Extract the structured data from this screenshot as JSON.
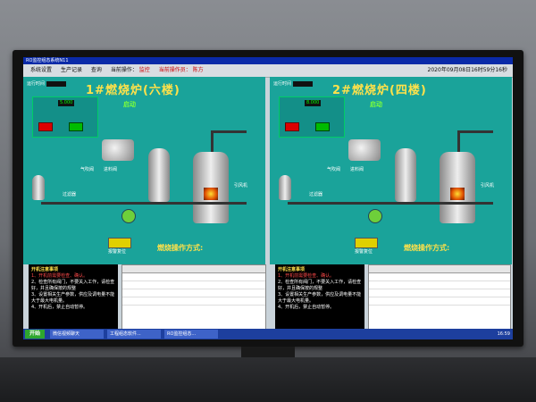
{
  "window": {
    "title": "RO监控组态系统N11"
  },
  "menu": {
    "items": [
      "系统设置",
      "生产记录",
      "查询"
    ],
    "status_prefix": "当前操作：",
    "status_value": "监控",
    "operator_prefix": "当前操作员：",
    "operator": "陈方"
  },
  "datetime": "2020年09月08日16时59分16秒",
  "panels": [
    {
      "title": "1#燃烧炉(六楼)",
      "runtime_label": "运行时间",
      "fan_label": "引风机",
      "feed_label": "进料阀",
      "pump_label": "气吹阀",
      "valve_label": "过滤器",
      "start_stop": "启动",
      "op_sign": "燃烧操作方式:",
      "alarm_label": "报警复位",
      "freq": "5.000"
    },
    {
      "title": "2#燃烧炉(四楼)",
      "runtime_label": "运行时间",
      "fan_label": "引风机",
      "feed_label": "进料阀",
      "pump_label": "气吹阀",
      "valve_label": "过滤器",
      "start_stop": "启动",
      "op_sign": "燃烧操作方式:",
      "alarm_label": "报警复位",
      "freq": "8.000"
    }
  ],
  "notes": {
    "title": "开机注意事项",
    "lines": [
      "1、开机前需要检查、确认。",
      "2、检查所有阀门，不要关入工作，请检查好，并且确保按的规整",
      "3、设置相关生产参数，供应及调电量不能大于最大电机量。",
      "4、开机后，禁止自动暂停。"
    ]
  },
  "taskbar": {
    "start": "开始",
    "tasks": [
      "微信视频聊天",
      "工程组态软件...",
      "RO监控组态..."
    ],
    "clock": "16:59"
  },
  "colors": {
    "panel": "#1aa39a",
    "title": "#ffe14a"
  }
}
